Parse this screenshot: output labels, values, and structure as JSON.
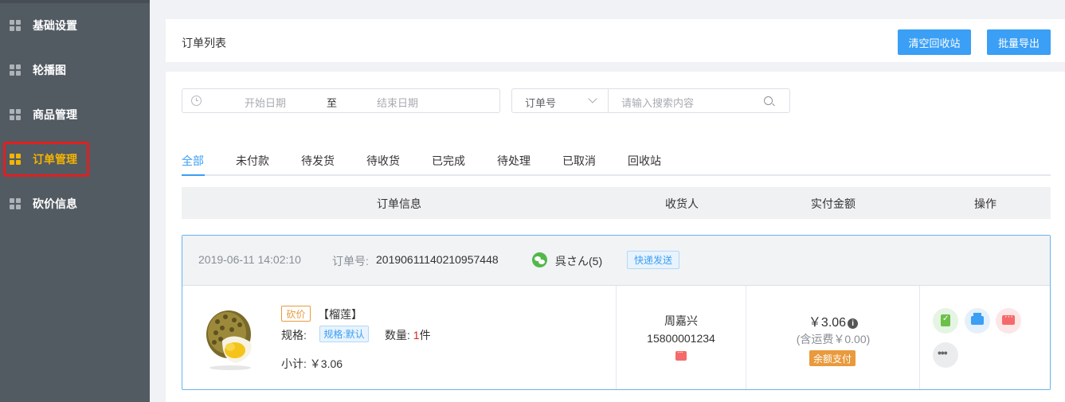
{
  "sidebar": {
    "items": [
      {
        "label": "基础设置"
      },
      {
        "label": "轮播图"
      },
      {
        "label": "商品管理"
      },
      {
        "label": "订单管理"
      },
      {
        "label": "砍价信息"
      }
    ],
    "active_color": "#f5b400"
  },
  "header": {
    "title": "订单列表",
    "btn_clear_recycle": "清空回收站",
    "btn_batch_export": "批量导出"
  },
  "filters": {
    "date_start_placeholder": "开始日期",
    "date_to": "至",
    "date_end_placeholder": "结束日期",
    "search_type": "订单号",
    "search_placeholder": "请输入搜索内容"
  },
  "tabs": [
    "全部",
    "未付款",
    "待发货",
    "待收货",
    "已完成",
    "待处理",
    "已取消",
    "回收站"
  ],
  "table": {
    "columns": [
      "订单信息",
      "收货人",
      "实付金额",
      "操作"
    ]
  },
  "order": {
    "time": "2019-06-11 14:02:10",
    "order_no_label": "订单号:",
    "order_no": "20190611140210957448",
    "user_name": "呉さん(5)",
    "ship_badge": "快递发送",
    "item_tag": "砍价",
    "product_name": "【榴莲】",
    "spec_label": "规格:",
    "spec_value": "规格:默认",
    "qty_label": "数量:",
    "qty_num": "1",
    "qty_unit": "件",
    "subtotal": "小计:  ￥3.06",
    "receiver_name": "周嘉兴",
    "receiver_phone": "15800001234",
    "amount": "￥3.06",
    "freight": "(含运费￥0.00)",
    "pay_badge": "余额支付"
  },
  "colors": {
    "primary": "#3a9ff5",
    "sidebar_bg": "#525a62",
    "highlight_border": "#e02020",
    "orange": "#e89a3c"
  }
}
